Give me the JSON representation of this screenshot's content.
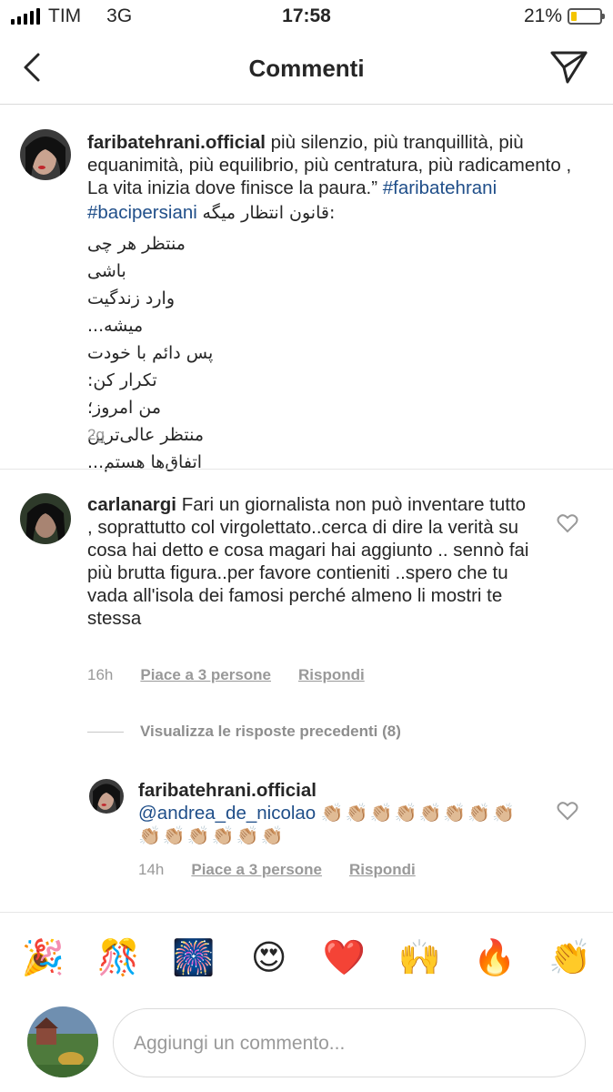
{
  "status_bar": {
    "carrier": "TIM",
    "network": "3G",
    "time": "17:58",
    "battery": "21%",
    "battery_level": 0.21
  },
  "header": {
    "title": "Commenti",
    "back_icon": "chevron-left-icon",
    "send_icon": "paper-plane-icon"
  },
  "caption": {
    "username": "faribatehrani.official",
    "text_it": "più silenzio, più tranquillità, più equanimità, più equilibrio, più centratura, più radicamento , La vita inizia dove finisce la paura.”",
    "hashtag1": "#faribatehrani",
    "hashtag2": "#bacipersiani",
    "fa_lines": [
      "قانون انتظار میگه:",
      "منتظر هر چی باشی",
      "وارد زندگیت میشه...",
      "پس دائم با خودت تکرار کن:",
      "من امروز؛",
      "منتظر عالی‌ترین",
      "اتفاق‌ها هستم..."
    ],
    "time": "2g"
  },
  "comments": [
    {
      "username": "carlanargi",
      "text": "Fari un giornalista non può inventare tutto , soprattutto col virgolettato..cerca di dire la verità su cosa hai detto e cosa magari hai aggiunto .. sennò fai più brutta figura..per favore contieniti ..spero che tu vada all'isola dei famosi perché  almeno li mostri te stessa",
      "time": "16h",
      "likes": "Piace a 3 persone",
      "reply": "Rispondi"
    }
  ],
  "view_previous": "Visualizza le risposte precedenti (8)",
  "reply": {
    "username": "faribatehrani.official",
    "mention": "@andrea_de_nicolao",
    "claps": "👏🏼👏🏼👏🏼👏🏼👏🏼👏🏼👏🏼👏🏼👏🏼👏🏼👏🏼👏🏼👏🏼👏🏼",
    "time": "14h",
    "likes": "Piace a 3 persone",
    "reply_label": "Rispondi"
  },
  "emoji_bar": [
    "🎉",
    "🎊",
    "🎆",
    "😍",
    "❤️",
    "🙌",
    "🔥",
    "👏"
  ],
  "composer": {
    "placeholder": "Aggiungi un commento..."
  }
}
